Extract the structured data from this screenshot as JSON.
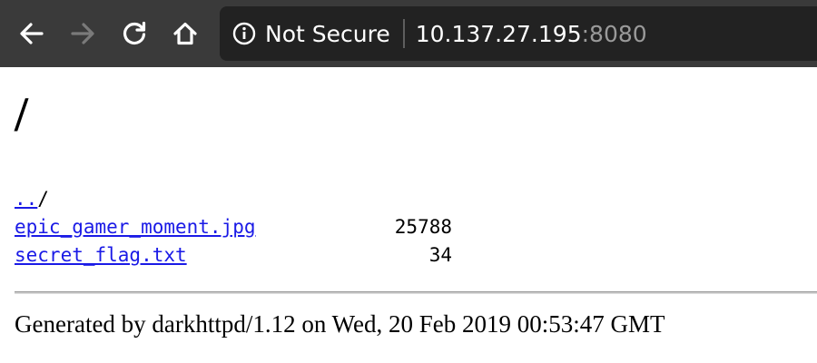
{
  "browser": {
    "security_label": "Not Secure",
    "url_host": "10.137.27.195",
    "url_port": ":8080",
    "icons": {
      "back": "arrow-left-icon",
      "forward": "arrow-right-icon",
      "reload": "reload-icon",
      "home": "home-icon",
      "info": "info-icon"
    },
    "colors": {
      "toolbar": "#3a3a3a",
      "omnibox": "#222222",
      "forward_disabled": "#7a7a7a"
    }
  },
  "page": {
    "title": "/",
    "listing": [
      {
        "name": "..",
        "suffix": "/",
        "size": ""
      },
      {
        "name": "epic_gamer_moment.jpg",
        "suffix": "",
        "size": "25788"
      },
      {
        "name": "secret_flag.txt",
        "suffix": "",
        "size": "34"
      }
    ],
    "footer": "Generated by darkhttpd/1.12 on Wed, 20 Feb 2019 00:53:47 GMT",
    "colors": {
      "link": "#1a1ae6"
    }
  }
}
